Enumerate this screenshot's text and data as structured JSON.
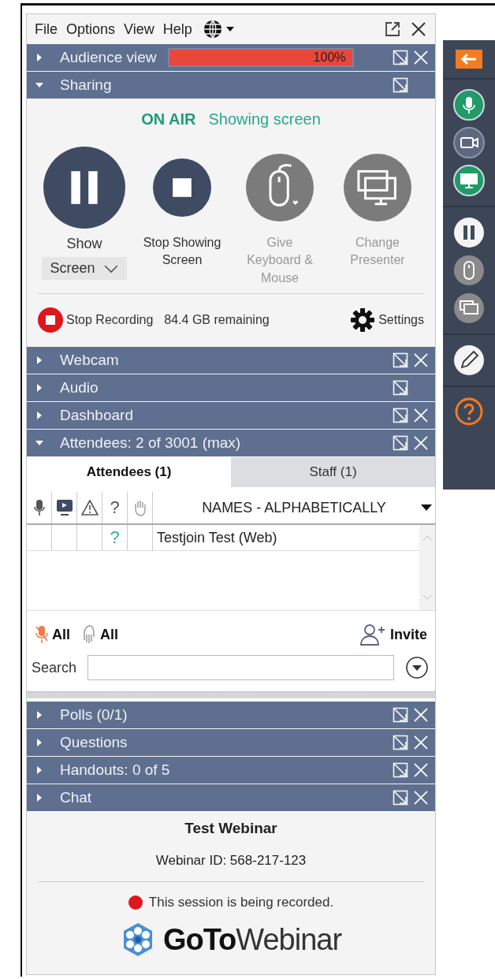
{
  "menu": [
    "File",
    "Options",
    "View",
    "Help"
  ],
  "panels": [
    {
      "title": "Audience view",
      "kind": "meter",
      "expanded": false,
      "closable": true,
      "level": 1,
      "reading": "100%"
    },
    {
      "title": "Sharing",
      "kind": "sharing",
      "expanded": true,
      "closable": false
    },
    {
      "title": "Webcam",
      "kind": "plain",
      "expanded": false,
      "closable": true
    },
    {
      "title": "Audio",
      "kind": "plain",
      "expanded": false,
      "closable": false
    },
    {
      "title": "Dashboard",
      "kind": "plain",
      "expanded": false,
      "closable": true
    },
    {
      "title": "Attendees:  2 of 3001 (max)",
      "kind": "attendees",
      "expanded": true,
      "closable": true
    },
    {
      "title": "Polls (0/1)",
      "kind": "plain",
      "expanded": false,
      "closable": true
    },
    {
      "title": "Questions",
      "kind": "plain",
      "expanded": false,
      "closable": true
    },
    {
      "title": "Handouts: 0 of 5",
      "kind": "plain",
      "expanded": false,
      "closable": true
    },
    {
      "title": "Chat",
      "kind": "plain",
      "expanded": false,
      "closable": true
    }
  ],
  "sharing": {
    "status": "ON AIR",
    "detail": "Showing screen",
    "actions": [
      {
        "kind": "pause",
        "label": "Show",
        "disabled": false,
        "dropdown": "Screen"
      },
      {
        "kind": "stop",
        "label": "Stop Showing Screen",
        "disabled": false
      },
      {
        "kind": "mouse",
        "label": "Give Keyboard & Mouse",
        "disabled": true
      },
      {
        "kind": "screens",
        "label": "Change Presenter",
        "disabled": true
      }
    ],
    "recording": {
      "label": "Stop Recording",
      "remaining": "84.4 GB remaining"
    },
    "settings": "Settings"
  },
  "attendees": {
    "tabs": [
      {
        "label": "Attendees (1)",
        "selected": true
      },
      {
        "label": "Staff (1)",
        "selected": false
      }
    ],
    "question_column": "?",
    "sort": "NAMES - ALPHABETICALLY",
    "rows": [
      {
        "question": "?",
        "name": "Testjoin Test (Web)"
      }
    ],
    "mute_all": "All",
    "lower_hands": "All",
    "invite": "Invite",
    "search_label": "Search"
  },
  "footer": {
    "title": "Test Webinar",
    "webinar_id": "Webinar ID: 568-217-123",
    "notice": "This session is being recorded.",
    "logo_bold": "GoTo",
    "logo_light": "Webinar"
  },
  "toolbar_groups": [
    [
      {
        "kind": "back"
      }
    ],
    [
      {
        "kind": "mic",
        "on": true
      },
      {
        "kind": "camera",
        "on": false
      },
      {
        "kind": "screen",
        "on": true
      }
    ],
    [
      {
        "kind": "pause"
      },
      {
        "kind": "mouse"
      },
      {
        "kind": "screens"
      }
    ],
    [
      {
        "kind": "pen"
      }
    ],
    [
      {
        "kind": "help"
      }
    ]
  ]
}
